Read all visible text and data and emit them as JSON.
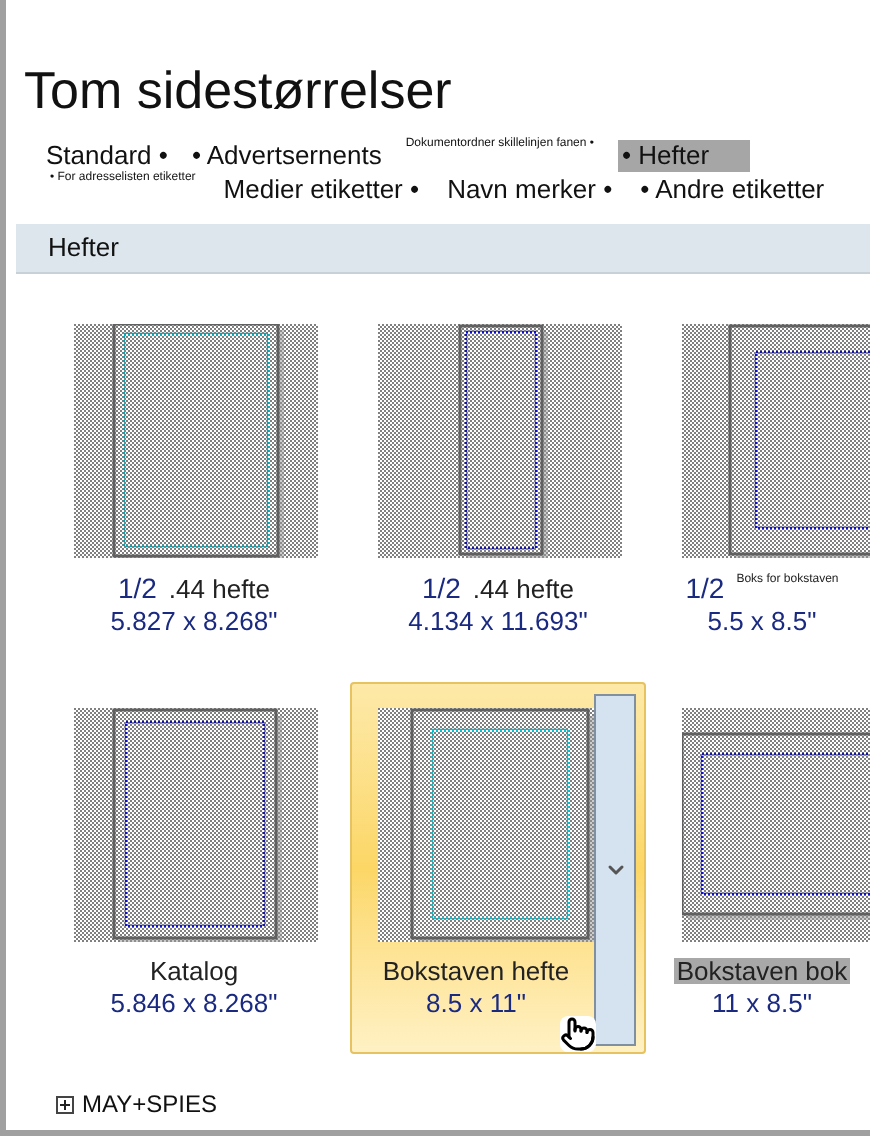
{
  "title": "Tom sidestørrelser",
  "category_rows": [
    [
      {
        "label": "Standard •",
        "kind": "large",
        "selected": false
      },
      {
        "label": "• Advertsernents",
        "kind": "large",
        "selected": false
      },
      {
        "label": "Dokumentordner skillelinjen fanen •",
        "kind": "small",
        "selected": false
      },
      {
        "label": "• Hefter",
        "kind": "large",
        "selected": true
      }
    ],
    [
      {
        "label": "• For adresselisten etiketter",
        "kind": "small",
        "selected": false
      },
      {
        "label": "Medier etiketter •",
        "kind": "large",
        "selected": false
      },
      {
        "label": "Navn merker •",
        "kind": "large",
        "selected": false
      },
      {
        "label": "• Andre etiketter",
        "kind": "large",
        "selected": false
      }
    ]
  ],
  "section": {
    "title": "Hefter"
  },
  "items": [
    {
      "prefix": "1/2",
      "name": ".44 hefte",
      "size": "5.827 x 8.268\"",
      "kind": "portrait",
      "selected": false,
      "highlighted": false
    },
    {
      "prefix": "1/2",
      "name": ".44 hefte",
      "size": "4.134 x 11.693\"",
      "kind": "narrow",
      "selected": false,
      "highlighted": false
    },
    {
      "prefix": "1/2",
      "name": "Boks for bokstaven",
      "small_name": true,
      "size": "5.5 x 8.5\"",
      "kind": "half",
      "selected": false,
      "highlighted": false
    },
    {
      "name": "Katalog",
      "size": "5.846 x 8.268\"",
      "kind": "catalog",
      "selected": false,
      "highlighted": false
    },
    {
      "name": "Bokstaven hefte",
      "size": "8.5 x 11\"",
      "kind": "letter",
      "selected": true,
      "highlighted": false
    },
    {
      "name": "Bokstaven bok",
      "size": "11 x 8.5\"",
      "kind": "landscape",
      "selected": false,
      "highlighted": true
    }
  ],
  "footer": {
    "label": "MAY+SPIES",
    "expanded": false
  }
}
